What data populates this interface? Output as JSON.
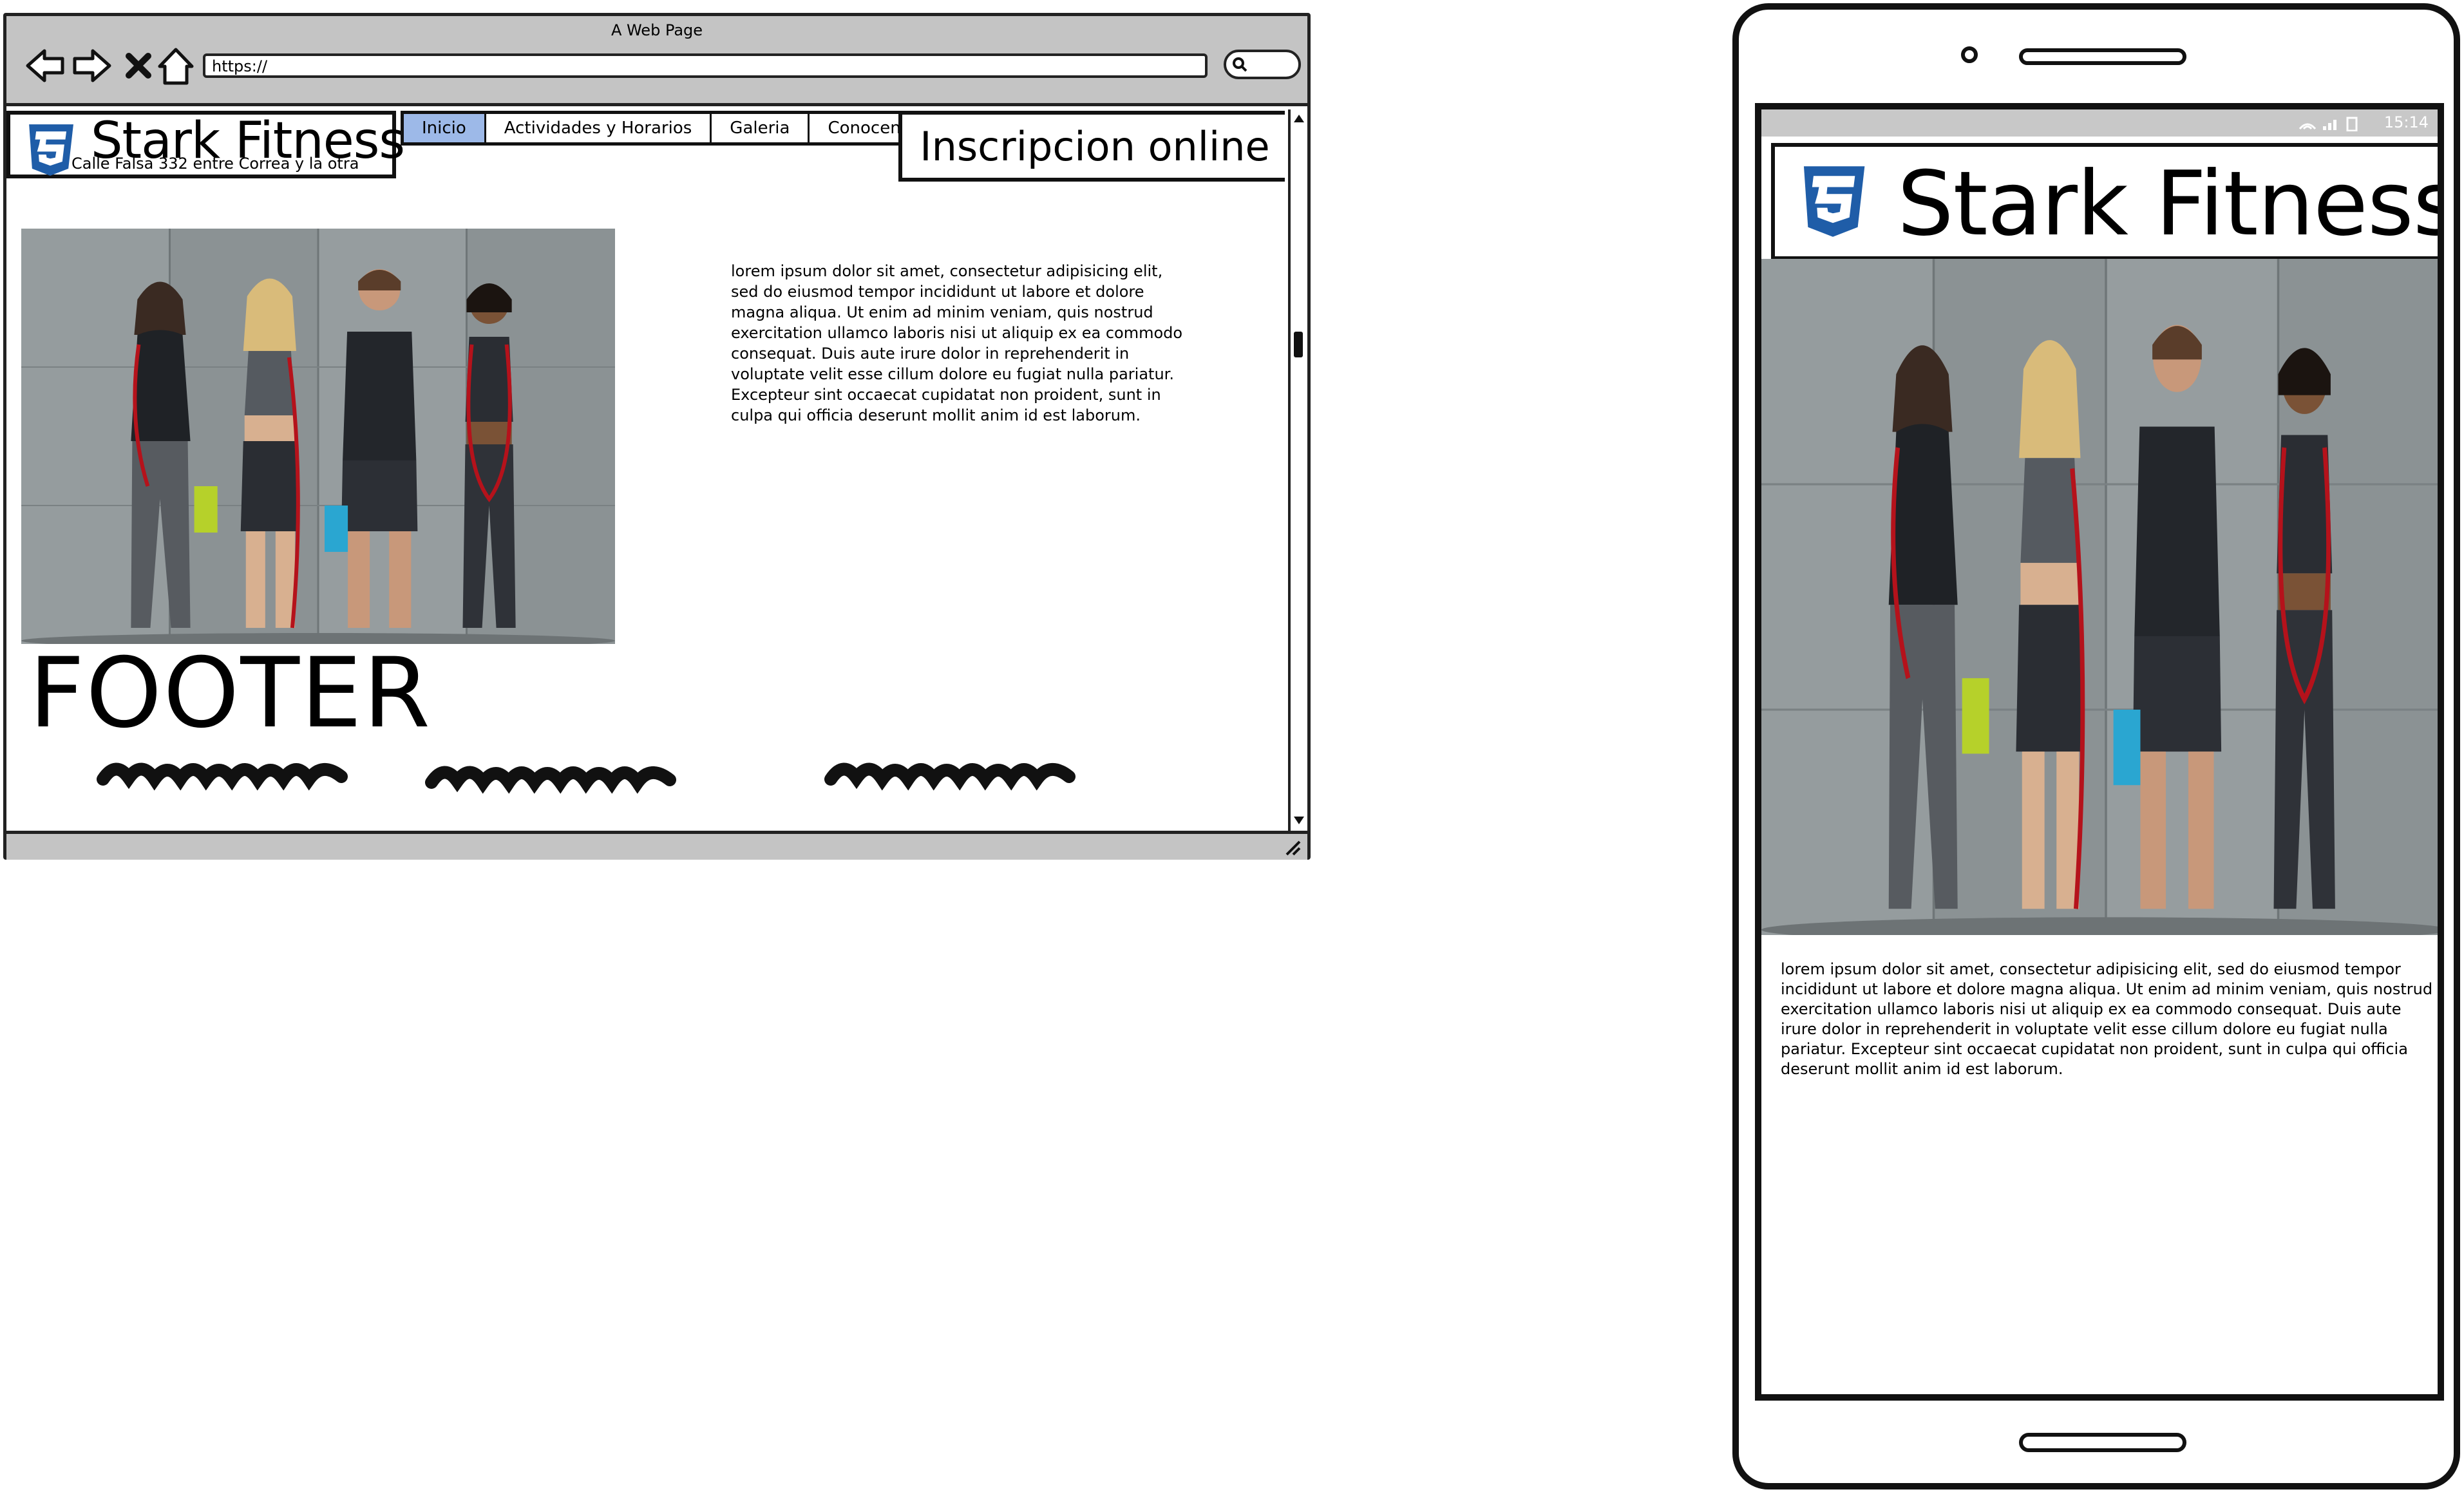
{
  "desktop": {
    "window_title": "A Web Page",
    "url": "https://",
    "icons": {
      "back": "arrow-left-icon",
      "forward": "arrow-right-icon",
      "stop": "close-icon",
      "home": "home-icon",
      "search": "search-icon"
    },
    "site_title": "Stark Fitness",
    "address": "Calle Falsa 332 entre Correa y la otra",
    "nav_tabs": [
      {
        "label": "Inicio",
        "active": true
      },
      {
        "label": "Actividades y Horarios",
        "active": false
      },
      {
        "label": "Galeria",
        "active": false
      },
      {
        "label": "Conocenos",
        "active": false
      }
    ],
    "signup_label": "Inscripcion online",
    "lorem": "lorem ipsum dolor sit amet, consectetur adipisicing elit, sed do eiusmod tempor incididunt ut labore et dolore magna aliqua. Ut enim ad minim veniam, quis nostrud exercitation ullamco laboris nisi ut aliquip ex ea commodo consequat. Duis aute irure dolor in reprehenderit in voluptate velit esse cillum dolore eu fugiat nulla pariatur. Excepteur sint occaecat cupidatat non proident, sunt in culpa qui officia deserunt mollit anim id est laborum.",
    "footer_label": "FOOTER"
  },
  "mobile": {
    "status_time": "15:14",
    "site_title": "Stark Fitness",
    "lorem": "lorem ipsum dolor sit amet, consectetur adipisicing elit, sed do eiusmod tempor incididunt ut labore et dolore magna aliqua. Ut enim ad minim veniam, quis nostrud exercitation ullamco laboris nisi ut aliquip ex ea commodo consequat. Duis aute irure dolor in reprehenderit in voluptate velit esse cillum dolore eu fugiat nulla pariatur. Excepteur sint occaecat cupidatat non proident, sunt in culpa qui officia deserunt mollit anim id est laborum."
  },
  "colors": {
    "chrome_gray": "#c4c4c4",
    "active_tab": "#9db9e8",
    "css3_blue": "#1f5da8",
    "wall": "#8b9294"
  }
}
